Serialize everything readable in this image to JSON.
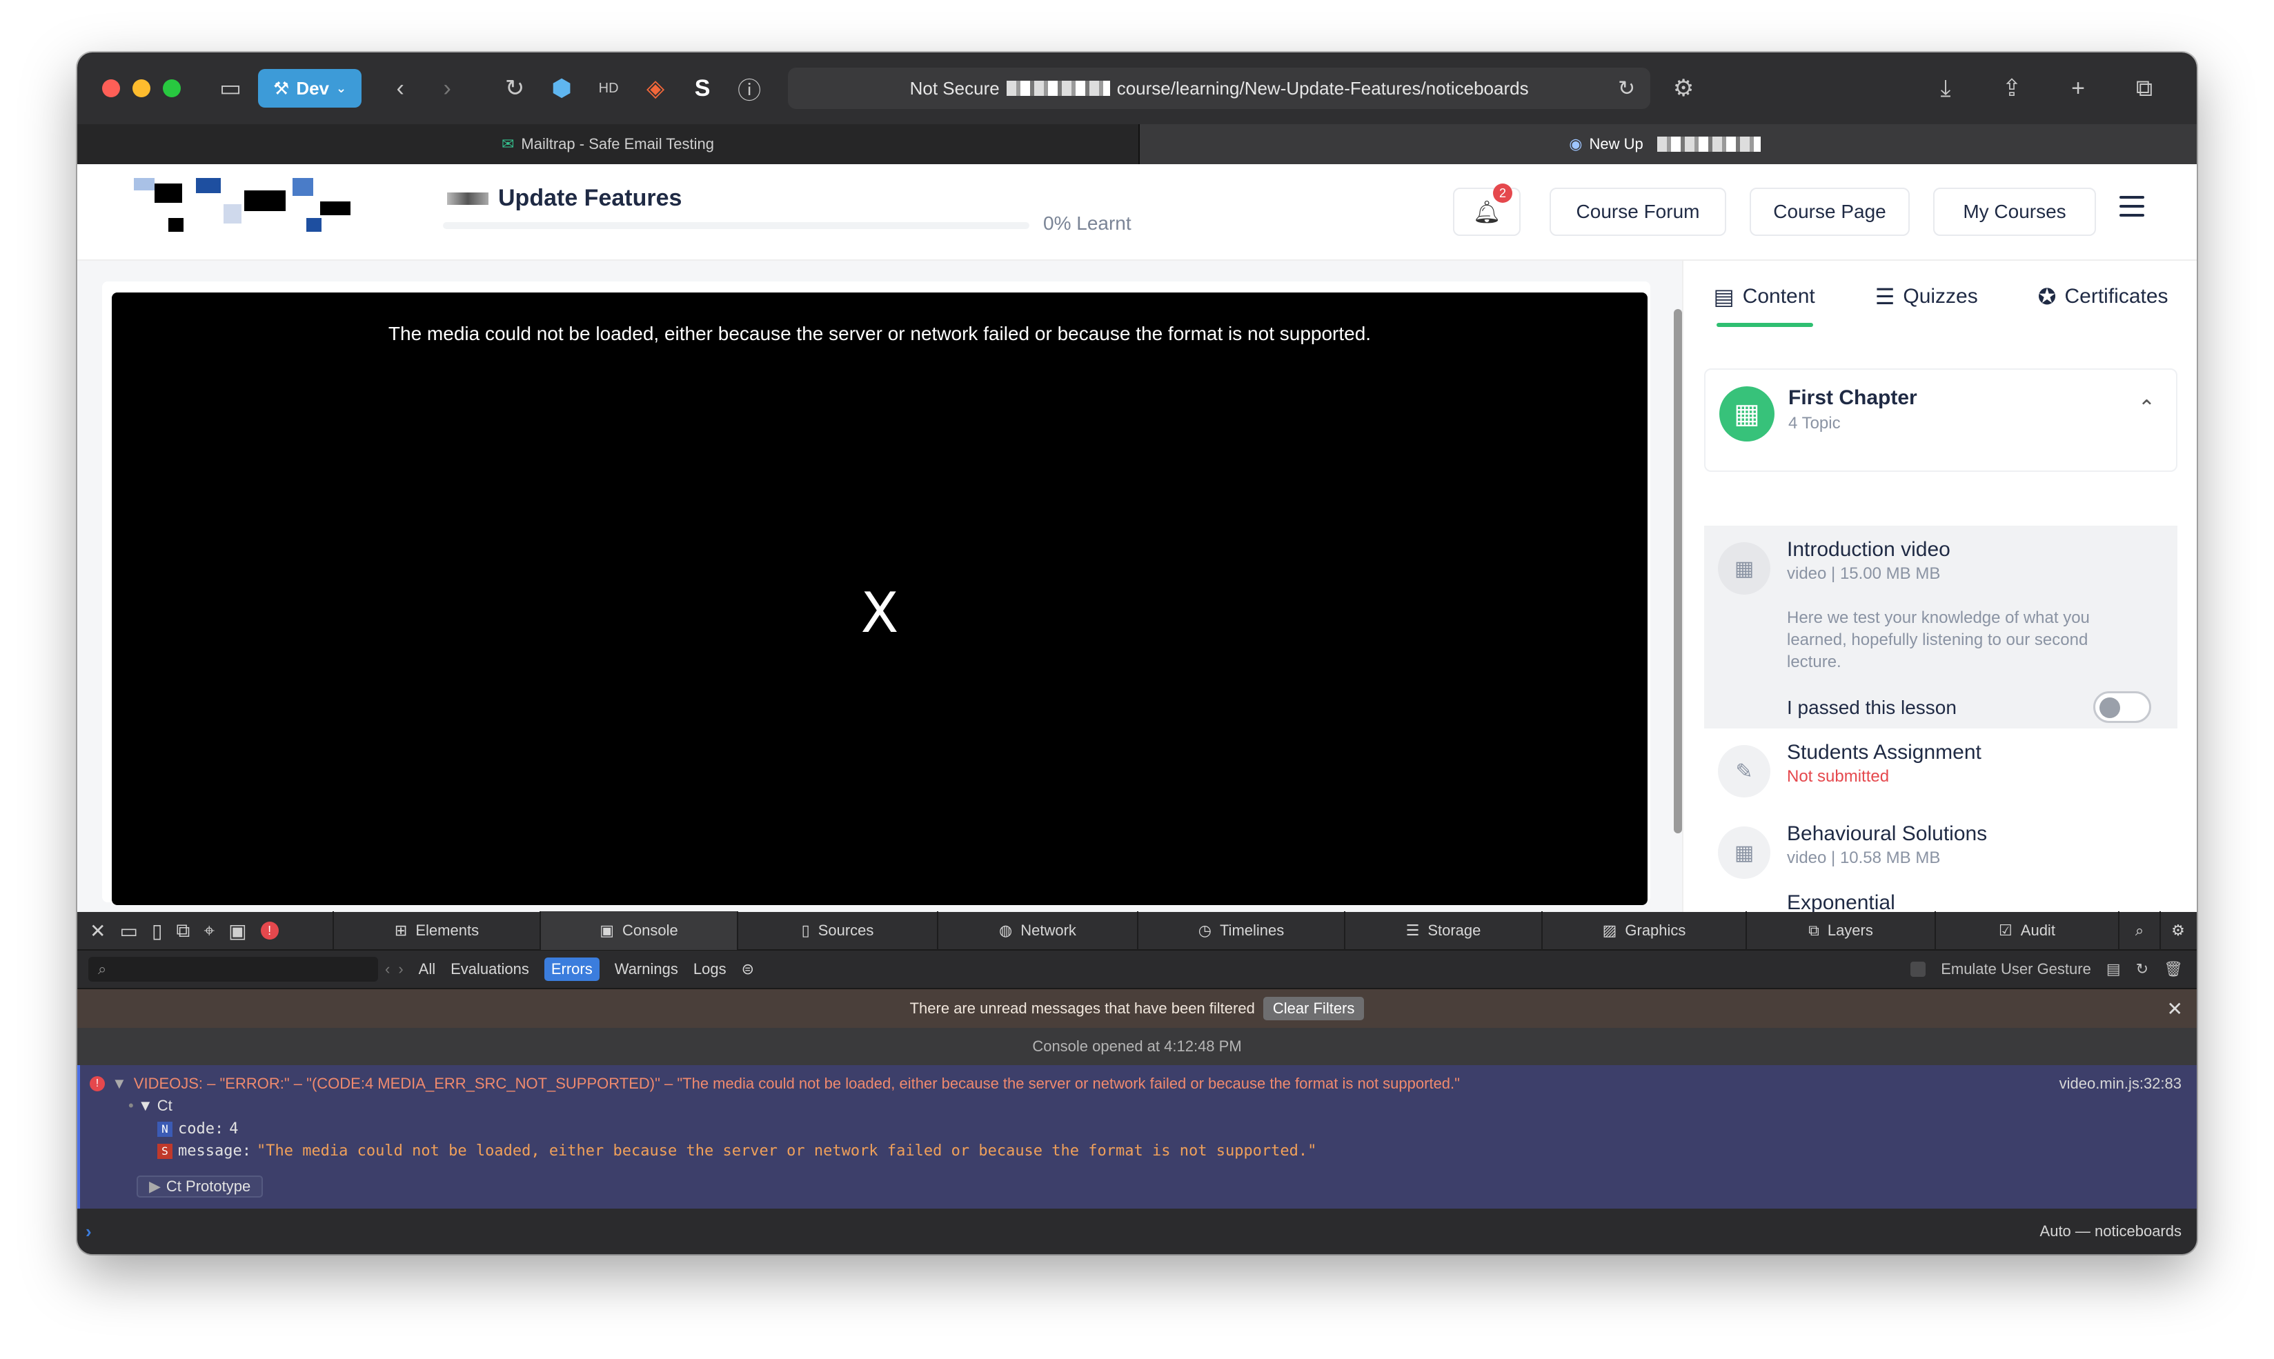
{
  "browser": {
    "dev_label": "Dev",
    "address_prefix": "Not Secure",
    "address_path": "course/learning/New-Update-Features/noticeboards",
    "tabs": [
      {
        "label": "Mailtrap - Safe Email Testing"
      },
      {
        "label": "New Up"
      }
    ]
  },
  "header": {
    "course_title": "Update Features",
    "progress_percent": 0,
    "progress_label": "0% Learnt",
    "notification_count": "2",
    "nav": {
      "forum": "Course Forum",
      "page": "Course Page",
      "my_courses": "My Courses"
    }
  },
  "video": {
    "error_message": "The media could not be loaded, either because the server or network failed or because the format is not supported.",
    "close_glyph": "X"
  },
  "sidebar": {
    "tabs": [
      {
        "label": "Content",
        "icon": "content-icon"
      },
      {
        "label": "Quizzes",
        "icon": "quiz-icon"
      },
      {
        "label": "Certificates",
        "icon": "certificate-icon"
      }
    ],
    "chapter": {
      "title": "First Chapter",
      "subtitle": "4 Topic"
    },
    "lessons": [
      {
        "title": "Introduction video",
        "subtitle": "video | 15.00 MB MB",
        "description": "Here we test your knowledge of what you learned, hopefully listening to our second lecture.",
        "passed_label": "I passed this lesson",
        "passed": false
      },
      {
        "title": "Students Assignment",
        "subtitle": "Not submitted"
      },
      {
        "title": "Behavioural Solutions",
        "subtitle": "video | 10.58 MB MB"
      },
      {
        "title": "Exponential"
      }
    ]
  },
  "devtools": {
    "error_count": "!",
    "tabs": [
      "Elements",
      "Console",
      "Sources",
      "Network",
      "Timelines",
      "Storage",
      "Graphics",
      "Layers",
      "Audit"
    ],
    "filters": [
      "All",
      "Evaluations",
      "Errors",
      "Warnings",
      "Logs"
    ],
    "emulate_label": "Emulate User Gesture",
    "notice": "There are unread messages that have been filtered",
    "clear_filters": "Clear Filters",
    "opened_at": "Console opened at 4:12:48 PM",
    "error": {
      "text": "VIDEOJS: – \"ERROR:\" – \"(CODE:4 MEDIA_ERR_SRC_NOT_SUPPORTED)\" – \"The media could not be loaded, either because the server or network failed or because the format is not supported.\"",
      "source": "video.min.js:32:83",
      "object_label": "▼ Ct",
      "code_key": "code:",
      "code_value": "4",
      "message_key": "message:",
      "message_value": "\"The media could not be loaded, either because the server or network failed or because the format is not supported.\"",
      "prototype": "Ct Prototype"
    },
    "context": "Auto — noticeboards"
  }
}
